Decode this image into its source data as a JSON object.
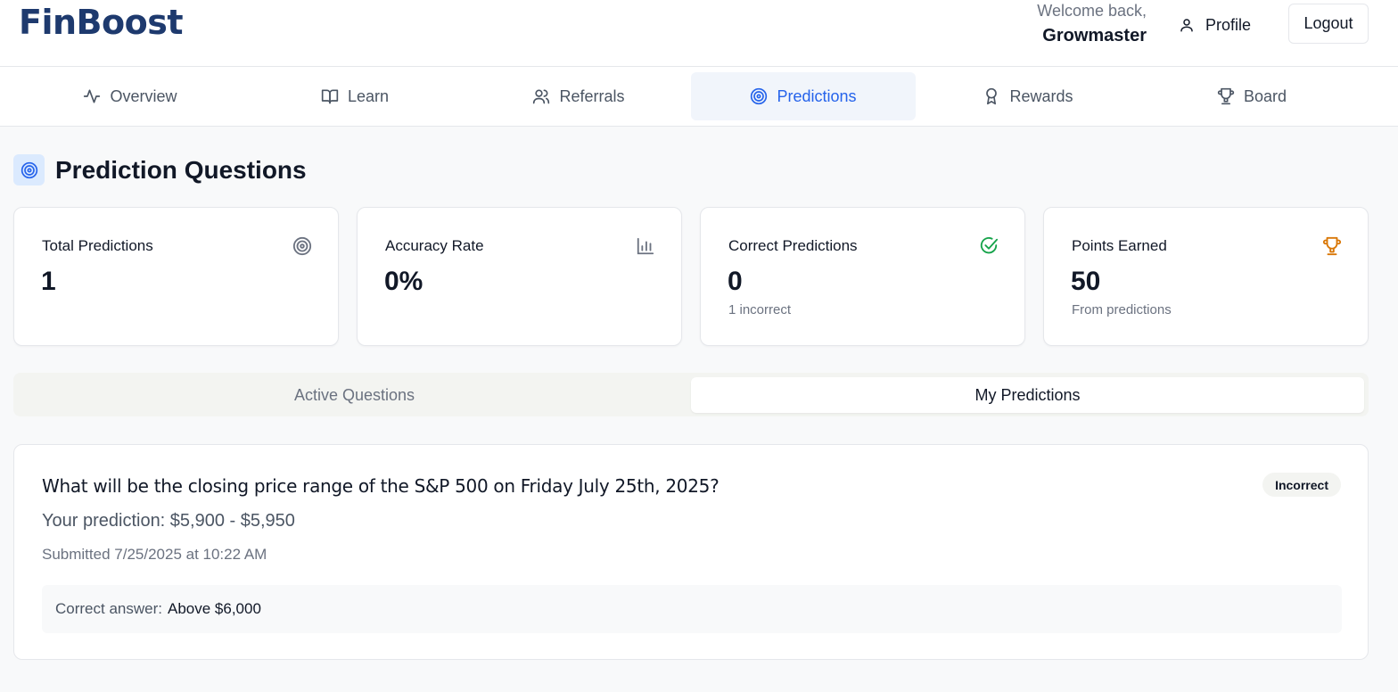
{
  "header": {
    "logo": "FinBoost",
    "welcome_line": "Welcome back,",
    "username": "Growmaster",
    "profile_label": "Profile",
    "logout_label": "Logout"
  },
  "nav": {
    "items": [
      {
        "label": "Overview",
        "icon": "activity-icon"
      },
      {
        "label": "Learn",
        "icon": "book-icon"
      },
      {
        "label": "Referrals",
        "icon": "users-icon"
      },
      {
        "label": "Predictions",
        "icon": "target-icon",
        "active": true
      },
      {
        "label": "Rewards",
        "icon": "award-icon"
      },
      {
        "label": "Board",
        "icon": "trophy-icon"
      }
    ]
  },
  "page": {
    "title": "Prediction Questions"
  },
  "stats": [
    {
      "label": "Total Predictions",
      "value": "1",
      "sub": "",
      "icon": "target-icon"
    },
    {
      "label": "Accuracy Rate",
      "value": "0%",
      "sub": "",
      "icon": "bar-chart-icon"
    },
    {
      "label": "Correct Predictions",
      "value": "0",
      "sub": "1 incorrect",
      "icon": "check-circle-icon"
    },
    {
      "label": "Points Earned",
      "value": "50",
      "sub": "From predictions",
      "icon": "trophy-icon"
    }
  ],
  "tabs": [
    {
      "label": "Active Questions",
      "active": false
    },
    {
      "label": "My Predictions",
      "active": true
    }
  ],
  "prediction": {
    "question": "What will be the closing price range of the S&P 500 on Friday July 25th, 2025?",
    "status": "Incorrect",
    "your_prediction": "Your prediction: $5,900 - $5,950",
    "submitted": "Submitted 7/25/2025 at 10:22 AM",
    "correct_label": "Correct answer:",
    "correct_value": "Above $6,000"
  },
  "colors": {
    "brand": "#1e3a6e",
    "accent": "#2563eb",
    "success": "#16a34a",
    "gold": "#d97706"
  }
}
